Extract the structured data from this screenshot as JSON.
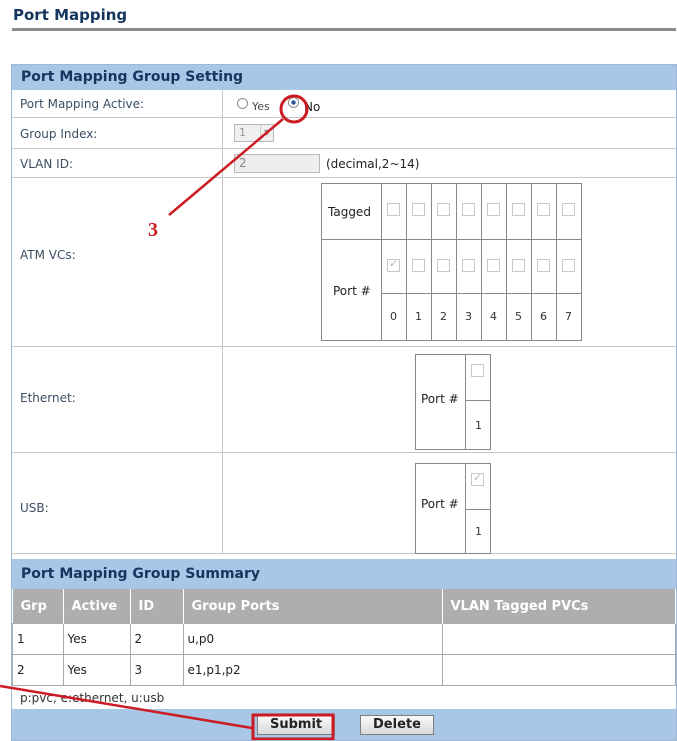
{
  "page_title": "Port Mapping",
  "group_setting": {
    "header": "Port Mapping Group Setting",
    "active_label": "Port Mapping Active:",
    "yes_label": "Yes",
    "no_label": "No",
    "active_value": "No",
    "group_index_label": "Group Index:",
    "group_index_value": "1",
    "vlan_label": "VLAN ID:",
    "vlan_value": "2",
    "vlan_hint": "(decimal,2~14)",
    "atm_label": "ATM VCs:",
    "tagged_label": "Tagged",
    "port_label": "Port #",
    "atm_ports": [
      "0",
      "1",
      "2",
      "3",
      "4",
      "5",
      "6",
      "7"
    ],
    "atm_tagged": [
      false,
      false,
      false,
      false,
      false,
      false,
      false,
      false
    ],
    "atm_port_checked": [
      true,
      false,
      false,
      false,
      false,
      false,
      false,
      false
    ],
    "ethernet_label": "Ethernet:",
    "ethernet_port": "1",
    "ethernet_checked": false,
    "usb_label": "USB:",
    "usb_port": "1",
    "usb_checked": true
  },
  "summary": {
    "header": "Port Mapping Group Summary",
    "columns": [
      "Grp",
      "Active",
      "ID",
      "Group Ports",
      "VLAN Tagged PVCs"
    ],
    "rows": [
      [
        "1",
        "Yes",
        "2",
        "u,p0",
        ""
      ],
      [
        "2",
        "Yes",
        "3",
        "e1,p1,p2",
        ""
      ]
    ],
    "legend": "p:pvc, e:ethernet, u:usb"
  },
  "buttons": {
    "submit": "Submit",
    "delete": "Delete"
  },
  "annotation": {
    "step_label": "3",
    "color": "#cc1b22"
  }
}
